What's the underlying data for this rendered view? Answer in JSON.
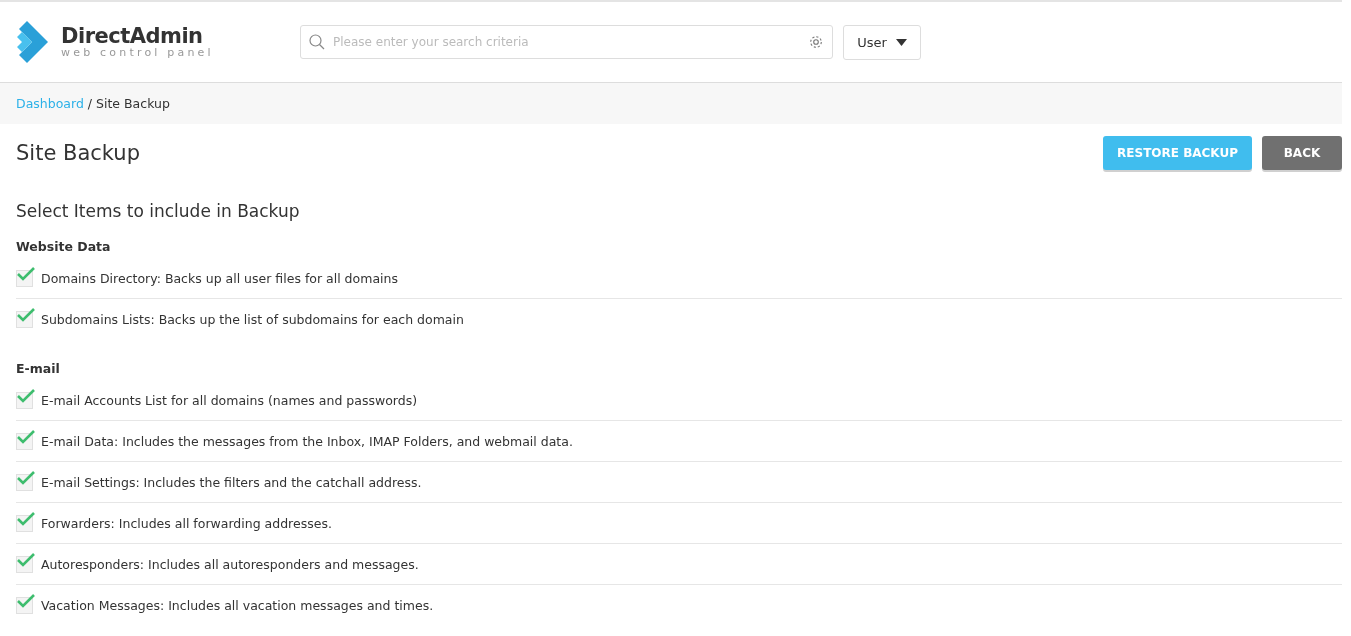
{
  "header": {
    "logo_title": "DirectAdmin",
    "logo_subtitle": "web control panel",
    "search": {
      "placeholder": "Please enter your search criteria"
    },
    "user_menu": "User"
  },
  "breadcrumb": [
    {
      "label": "Dashboard",
      "kind": "link"
    },
    {
      "label": "/",
      "kind": "separator"
    },
    {
      "label": "Site Backup",
      "kind": "current"
    }
  ],
  "page_title": "Site Backup",
  "buttons": [
    {
      "label": "RESTORE BACKUP",
      "kind": "primary"
    },
    {
      "label": "BACK",
      "kind": "secondary"
    }
  ],
  "section_title": "Select Items to include in Backup",
  "groups": [
    {
      "title": "Website Data",
      "items": [
        {
          "label": "Domains Directory: Backs up all user files for all domains",
          "checked": true
        },
        {
          "label": "Subdomains Lists: Backs up the list of subdomains for each domain",
          "checked": true
        }
      ]
    },
    {
      "title": "E-mail",
      "items": [
        {
          "label": "E-mail Accounts List for all domains (names and passwords)",
          "checked": true
        },
        {
          "label": "E-mail Data: Includes the messages from the Inbox, IMAP Folders, and webmail data.",
          "checked": true
        },
        {
          "label": "E-mail Settings: Includes the filters and the catchall address.",
          "checked": true
        },
        {
          "label": "Forwarders: Includes all forwarding addresses.",
          "checked": true
        },
        {
          "label": "Autoresponders: Includes all autoresponders and messages.",
          "checked": true
        },
        {
          "label": "Vacation Messages: Includes all vacation messages and times.",
          "checked": true
        }
      ]
    }
  ]
}
